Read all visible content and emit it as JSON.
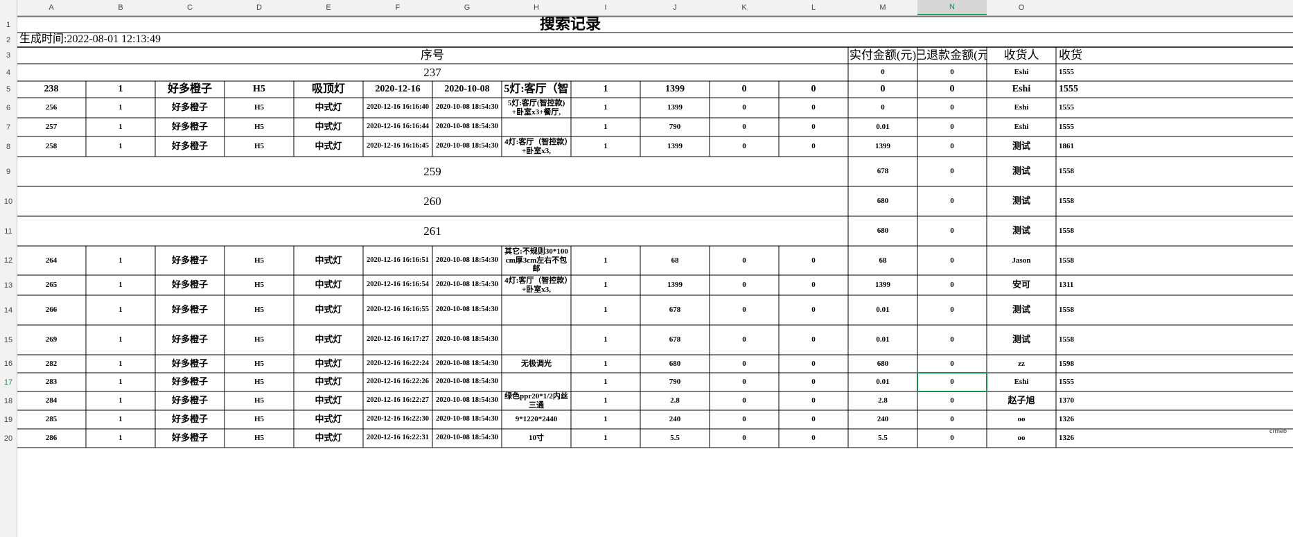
{
  "sheet": {
    "columns": [
      "A",
      "B",
      "C",
      "D",
      "E",
      "F",
      "G",
      "H",
      "I",
      "J",
      "K",
      "L",
      "M",
      "N",
      "O",
      ""
    ],
    "selected_column": "N",
    "selected_row": "17",
    "selected_cell_value": "0"
  },
  "title": "搜索记录",
  "generated": "生成时间:2022-08-01 12:13:49",
  "header": {
    "seq": "序号",
    "paid": "实付金额(元)",
    "refund": "已退款金额(元",
    "receiver": "收货人",
    "phone": "收货"
  },
  "rows": [
    {
      "num": "4",
      "merged": true,
      "seq": "237",
      "m": "0",
      "n": "0",
      "o": "Eshi",
      "p": "1555"
    },
    {
      "num": "5",
      "big": true,
      "cells": [
        "238",
        "1",
        "好多橙子",
        "H5",
        "吸顶灯",
        "2020-12-16",
        "2020-10-08",
        "5灯:客厅（智",
        "1",
        "1399",
        "0",
        "0",
        "0",
        "0",
        "Eshi",
        "1555"
      ]
    },
    {
      "num": "6",
      "cells": [
        "256",
        "1",
        "好多橙子",
        "H5",
        "中式灯",
        "2020-12-16 16:16:40",
        "2020-10-08 18:54:30",
        "5灯:客厅(智控款)+卧室x3+餐厅,",
        "1",
        "1399",
        "0",
        "0",
        "0",
        "0",
        "Eshi",
        "1555"
      ]
    },
    {
      "num": "7",
      "cells": [
        "257",
        "1",
        "好多橙子",
        "H5",
        "中式灯",
        "2020-12-16 16:16:44",
        "2020-10-08 18:54:30",
        "",
        "1",
        "790",
        "0",
        "0",
        "0.01",
        "0",
        "Eshi",
        "1555"
      ]
    },
    {
      "num": "8",
      "cells": [
        "258",
        "1",
        "好多橙子",
        "H5",
        "中式灯",
        "2020-12-16 16:16:45",
        "2020-10-08 18:54:30",
        "4灯:客厅（智控款）+卧室x3,",
        "1",
        "1399",
        "0",
        "0",
        "1399",
        "0",
        "测试",
        "1861"
      ]
    },
    {
      "num": "9",
      "merged": true,
      "seq": "259",
      "m": "678",
      "n": "0",
      "o": "测试",
      "p": "1558"
    },
    {
      "num": "10",
      "merged": true,
      "seq": "260",
      "m": "680",
      "n": "0",
      "o": "测试",
      "p": "1558"
    },
    {
      "num": "11",
      "merged": true,
      "seq": "261",
      "m": "680",
      "n": "0",
      "o": "测试",
      "p": "1558"
    },
    {
      "num": "12",
      "cells": [
        "264",
        "1",
        "好多橙子",
        "H5",
        "中式灯",
        "2020-12-16 16:16:51",
        "2020-10-08 18:54:30",
        "其它:不规则30*100cm厚3cm左右不包邮",
        "1",
        "68",
        "0",
        "0",
        "68",
        "0",
        "Jason",
        "1558"
      ]
    },
    {
      "num": "13",
      "cells": [
        "265",
        "1",
        "好多橙子",
        "H5",
        "中式灯",
        "2020-12-16 16:16:54",
        "2020-10-08 18:54:30",
        "4灯:客厅（智控款）+卧室x3,",
        "1",
        "1399",
        "0",
        "0",
        "1399",
        "0",
        "安可",
        "1311"
      ]
    },
    {
      "num": "14",
      "cells": [
        "266",
        "1",
        "好多橙子",
        "H5",
        "中式灯",
        "2020-12-16 16:16:55",
        "2020-10-08 18:54:30",
        "",
        "1",
        "678",
        "0",
        "0",
        "0.01",
        "0",
        "测试",
        "1558"
      ]
    },
    {
      "num": "15",
      "cells": [
        "269",
        "1",
        "好多橙子",
        "H5",
        "中式灯",
        "2020-12-16 16:17:27",
        "2020-10-08 18:54:30",
        "",
        "1",
        "678",
        "0",
        "0",
        "0.01",
        "0",
        "测试",
        "1558"
      ]
    },
    {
      "num": "16",
      "cells": [
        "282",
        "1",
        "好多橙子",
        "H5",
        "中式灯",
        "2020-12-16 16:22:24",
        "2020-10-08 18:54:30",
        "无极调光",
        "1",
        "680",
        "0",
        "0",
        "680",
        "0",
        "zz",
        "1598"
      ]
    },
    {
      "num": "17",
      "cells": [
        "283",
        "1",
        "好多橙子",
        "H5",
        "中式灯",
        "2020-12-16 16:22:26",
        "2020-10-08 18:54:30",
        "",
        "1",
        "790",
        "0",
        "0",
        "0.01",
        "0",
        "Eshi",
        "1555"
      ]
    },
    {
      "num": "18",
      "cells": [
        "284",
        "1",
        "好多橙子",
        "H5",
        "中式灯",
        "2020-12-16 16:22:27",
        "2020-10-08 18:54:30",
        "绿色ppr20*1/2内丝三通",
        "1",
        "2.8",
        "0",
        "0",
        "2.8",
        "0",
        "赵子旭",
        "1370"
      ]
    },
    {
      "num": "19",
      "cells": [
        "285",
        "1",
        "好多橙子",
        "H5",
        "中式灯",
        "2020-12-16 16:22:30",
        "2020-10-08 18:54:30",
        "9*1220*2440",
        "1",
        "240",
        "0",
        "0",
        "240",
        "0",
        "oo",
        "1326"
      ]
    },
    {
      "num": "20",
      "cells": [
        "286",
        "1",
        "好多橙子",
        "H5",
        "中式灯",
        "2020-12-16 16:22:31",
        "2020-10-08 18:54:30",
        "10寸",
        "1",
        "5.5",
        "0",
        "0",
        "5.5",
        "0",
        "oo",
        "1326"
      ]
    }
  ],
  "watermark": "crmeb"
}
